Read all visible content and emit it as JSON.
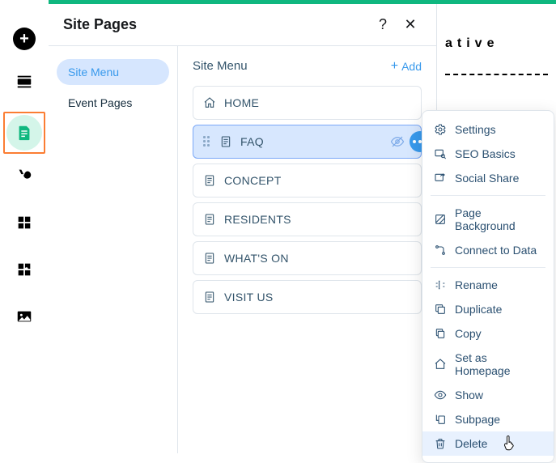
{
  "panel": {
    "title": "Site Pages",
    "help_tooltip": "?",
    "close_tooltip": "✕"
  },
  "tabs": [
    {
      "label": "Site Menu",
      "active": true
    },
    {
      "label": "Event Pages",
      "active": false
    }
  ],
  "content": {
    "title": "Site Menu",
    "add_label": "Add"
  },
  "pages": [
    {
      "label": "HOME",
      "icon": "home"
    },
    {
      "label": "FAQ",
      "icon": "page",
      "selected": true
    },
    {
      "label": "CONCEPT",
      "icon": "page"
    },
    {
      "label": "RESIDENTS",
      "icon": "page"
    },
    {
      "label": "WHAT'S ON",
      "icon": "page"
    },
    {
      "label": "VISIT US",
      "icon": "page"
    }
  ],
  "context_menu": [
    {
      "label": "Settings",
      "icon": "gear"
    },
    {
      "label": "SEO Basics",
      "icon": "seo"
    },
    {
      "label": "Social Share",
      "icon": "share"
    },
    {
      "sep": true
    },
    {
      "label": "Page Background",
      "icon": "background"
    },
    {
      "label": "Connect to Data",
      "icon": "data"
    },
    {
      "sep": true
    },
    {
      "label": "Rename",
      "icon": "rename"
    },
    {
      "label": "Duplicate",
      "icon": "duplicate"
    },
    {
      "label": "Copy",
      "icon": "copy"
    },
    {
      "label": "Set as Homepage",
      "icon": "homepage"
    },
    {
      "label": "Show",
      "icon": "show"
    },
    {
      "label": "Subpage",
      "icon": "subpage"
    },
    {
      "label": "Delete",
      "icon": "delete",
      "hover": true
    }
  ],
  "background": {
    "partial_heading": "ative"
  }
}
